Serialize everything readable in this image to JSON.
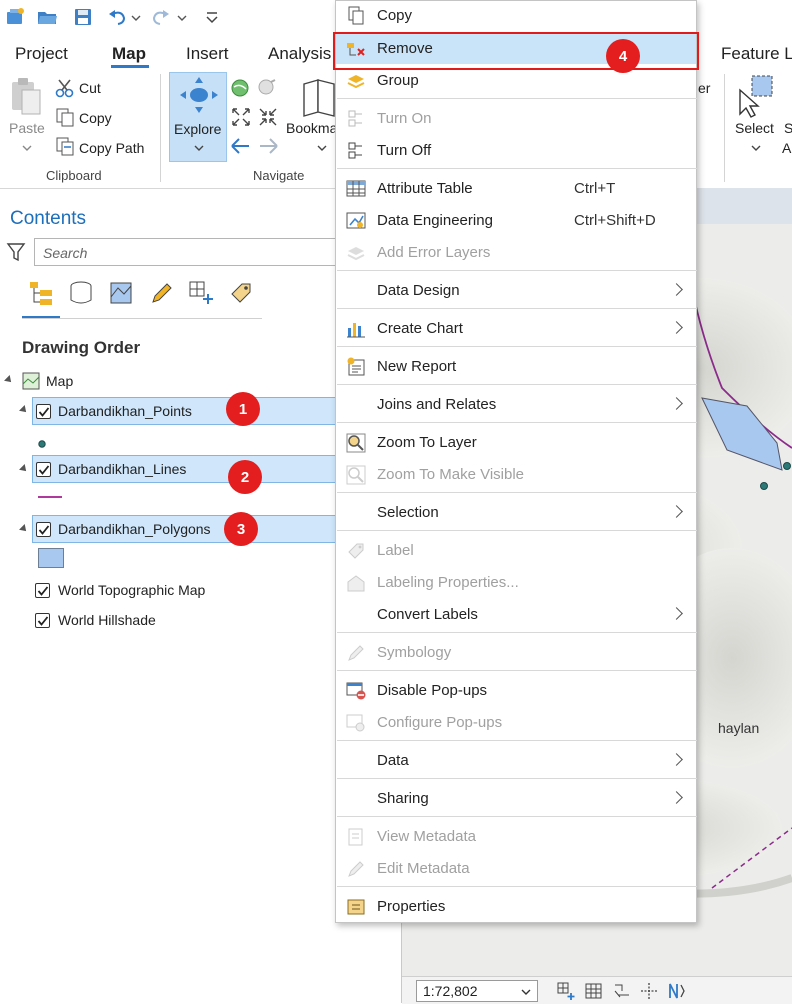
{
  "ribbon": {
    "tabs": [
      {
        "label": "Project"
      },
      {
        "label": "Map"
      },
      {
        "label": "Insert"
      },
      {
        "label": "Analysis"
      },
      {
        "label": "Feature L"
      }
    ],
    "clipboard": {
      "paste": "Paste",
      "cut": "Cut",
      "copy": "Copy",
      "copy_path": "Copy Path",
      "group_label": "Clipboard"
    },
    "navigate": {
      "explore": "Explore",
      "bookmarks": "Bookma",
      "group_label": "Navigate"
    },
    "selection": {
      "select": "Select",
      "partial_top": "S",
      "partial_bottom": "A",
      "partial_er": "er"
    }
  },
  "contents": {
    "title": "Contents",
    "search_placeholder": "Search",
    "section_title": "Drawing Order",
    "map_label": "Map",
    "layers": [
      {
        "label": "Darbandikhan_Points",
        "badge": "1"
      },
      {
        "label": "Darbandikhan_Lines",
        "badge": "2"
      },
      {
        "label": "Darbandikhan_Polygons",
        "badge": "3"
      }
    ],
    "basemaps": [
      {
        "label": "World Topographic Map"
      },
      {
        "label": "World Hillshade"
      }
    ]
  },
  "map": {
    "place_label": "haylan",
    "scale": "1:72,802"
  },
  "context_menu": {
    "highlight_badge": "4",
    "items": {
      "copy": "Copy",
      "remove": "Remove",
      "group": "Group",
      "turn_on": "Turn On",
      "turn_off": "Turn Off",
      "attribute_table": "Attribute Table",
      "attribute_table_shortcut": "Ctrl+T",
      "data_engineering": "Data Engineering",
      "data_engineering_shortcut": "Ctrl+Shift+D",
      "add_error_layers": "Add Error Layers",
      "data_design": "Data Design",
      "create_chart": "Create Chart",
      "new_report": "New Report",
      "joins_relates": "Joins and Relates",
      "zoom_to_layer": "Zoom To Layer",
      "zoom_visible": "Zoom To Make Visible",
      "selection": "Selection",
      "label": "Label",
      "labeling_properties": "Labeling Properties...",
      "convert_labels": "Convert Labels",
      "symbology": "Symbology",
      "disable_popups": "Disable Pop-ups",
      "configure_popups": "Configure Pop-ups",
      "data": "Data",
      "sharing": "Sharing",
      "view_metadata": "View Metadata",
      "edit_metadata": "Edit Metadata",
      "properties": "Properties"
    }
  },
  "colors": {
    "accent": "#2f79c9",
    "selection_bg": "#cfe6fb",
    "menu_highlight": "#c9e4f8",
    "annotation_red": "#e41e1e",
    "polygon_fill": "#a8c8f0",
    "line_color": "#8b2b8b"
  }
}
